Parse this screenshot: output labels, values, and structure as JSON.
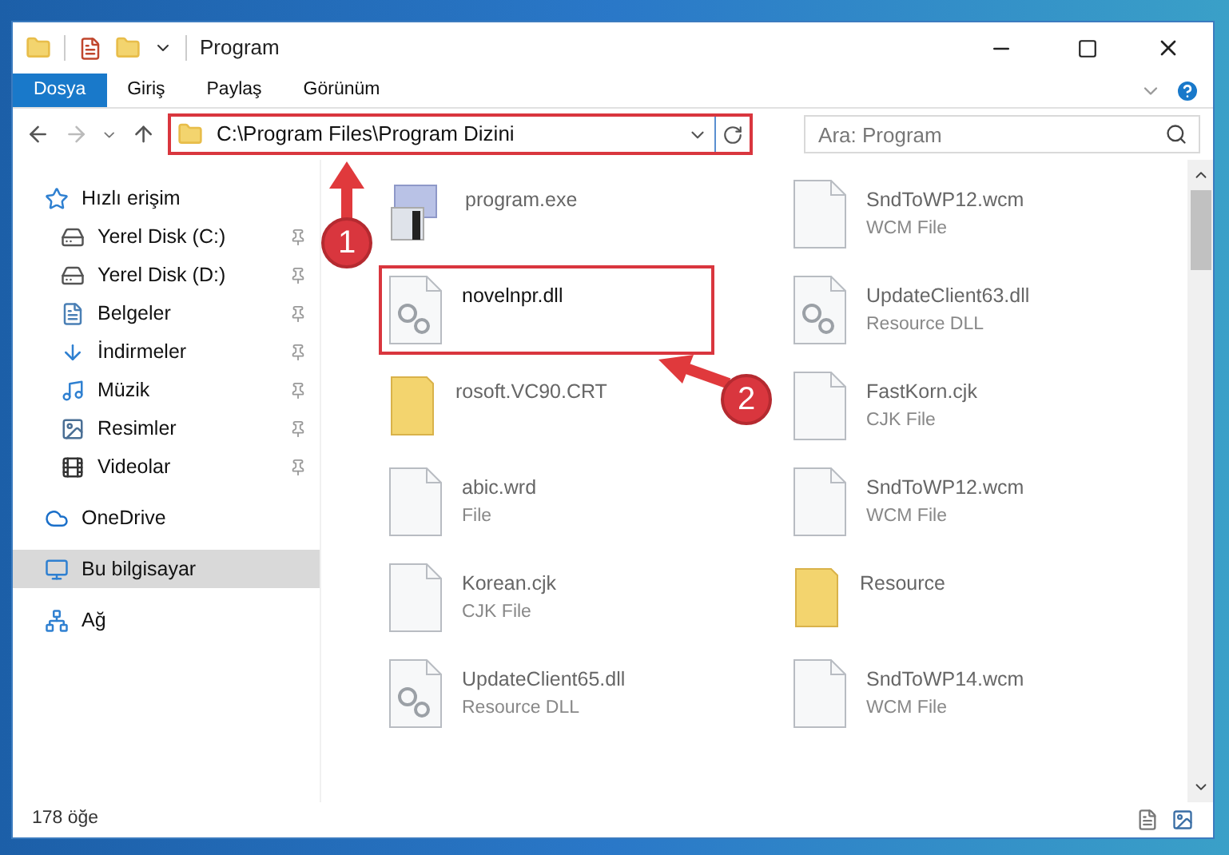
{
  "title_bar": {
    "title": "Program"
  },
  "ribbon": {
    "tabs": [
      {
        "label": "Dosya",
        "kind": "file"
      },
      {
        "label": "Giriş",
        "kind": "tab"
      },
      {
        "label": "Paylaş",
        "kind": "tab"
      },
      {
        "label": "Görünüm",
        "kind": "tab"
      }
    ]
  },
  "address_bar": {
    "path": "C:\\Program Files\\Program Dizini",
    "highlighted": true
  },
  "search": {
    "placeholder": "Ara: Program"
  },
  "sidebar": {
    "items": [
      {
        "label": "Hızlı erişim",
        "kind": "star",
        "selected": false,
        "children": [
          {
            "label": "Yerel Disk (C:)",
            "kind": "drive",
            "pinned": true,
            "selected": false
          },
          {
            "label": "Yerel Disk (D:)",
            "kind": "drive",
            "pinned": true,
            "selected": false
          },
          {
            "label": "Belgeler",
            "kind": "document",
            "pinned": true,
            "selected": false
          },
          {
            "label": "İndirmeler",
            "kind": "download",
            "pinned": true,
            "selected": false
          },
          {
            "label": "Müzik",
            "kind": "music",
            "pinned": true,
            "selected": false
          },
          {
            "label": "Resimler",
            "kind": "picture",
            "pinned": true,
            "selected": false
          },
          {
            "label": "Videolar",
            "kind": "film",
            "pinned": true,
            "selected": false
          }
        ]
      },
      {
        "label": "OneDrive",
        "kind": "cloud",
        "selected": false
      },
      {
        "label": "Bu bilgisayar",
        "kind": "computer",
        "selected": true
      },
      {
        "label": "Ağ",
        "kind": "network",
        "selected": false
      }
    ]
  },
  "files": [
    {
      "name": "program.exe",
      "kind": "exe",
      "highlighted": false
    },
    {
      "name": "SndToWP12.wcm",
      "type": "WCM File",
      "kind": "blank",
      "highlighted": false
    },
    {
      "name": "novelnpr.dll",
      "kind": "dll",
      "highlighted": true
    },
    {
      "name": "UpdateClient63.dll",
      "type": "Resource DLL",
      "kind": "dll",
      "highlighted": false
    },
    {
      "name": "rosoft.VC90.CRT",
      "kind": "folder",
      "highlighted": false
    },
    {
      "name": "FastKorn.cjk",
      "type": "CJK File",
      "kind": "blank",
      "highlighted": false
    },
    {
      "name": "abic.wrd",
      "type": "File",
      "kind": "blank",
      "highlighted": false
    },
    {
      "name": "SndToWP12.wcm",
      "type": "WCM File",
      "kind": "blank",
      "highlighted": false
    },
    {
      "name": "Korean.cjk",
      "type": "CJK File",
      "kind": "blank",
      "highlighted": false
    },
    {
      "name": "Resource",
      "kind": "folder",
      "highlighted": false
    },
    {
      "name": "UpdateClient65.dll",
      "type": "Resource DLL",
      "kind": "dll",
      "highlighted": false
    },
    {
      "name": "SndToWP14.wcm",
      "type": "WCM File",
      "kind": "blank",
      "highlighted": false
    }
  ],
  "annotations": [
    {
      "number": "1"
    },
    {
      "number": "2"
    }
  ],
  "status_bar": {
    "count": "178 öğe"
  }
}
